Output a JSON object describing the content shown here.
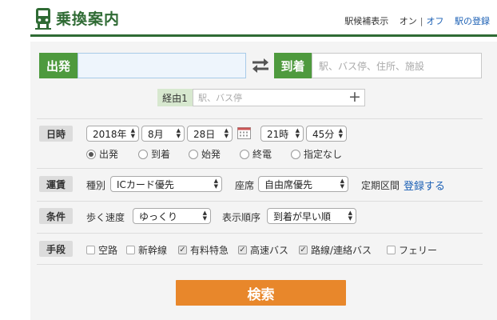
{
  "header": {
    "title": "乗換案内",
    "station_suggest_label": "駅候補表示",
    "suggest_on": "オン",
    "suggest_separator": "|",
    "suggest_off": "オフ",
    "register_stations": "駅の登録"
  },
  "route": {
    "from_label": "出発",
    "from_value": "",
    "to_label": "到着",
    "to_placeholder": "駅、バス停、住所、施設",
    "via_label": "経由1",
    "via_placeholder": "駅、バス停",
    "add_via": "+"
  },
  "datetime": {
    "label": "日時",
    "year": "2018年",
    "month": "8月",
    "day": "28日",
    "hour": "21時",
    "minute": "45分",
    "options": [
      "出発",
      "到着",
      "始発",
      "終電",
      "指定なし"
    ],
    "selected_index": 0
  },
  "fare": {
    "label": "運賃",
    "type_label": "種別",
    "type_value": "ICカード優先",
    "seat_label": "座席",
    "seat_value": "自由席優先",
    "commuter_label": "定期区間",
    "commuter_link": "登録する"
  },
  "conditions": {
    "label": "条件",
    "speed_label": "歩く速度",
    "speed_value": "ゆっくり",
    "order_label": "表示順序",
    "order_value": "到着が早い順"
  },
  "means": {
    "label": "手段",
    "options": [
      {
        "label": "空路",
        "checked": false
      },
      {
        "label": "新幹線",
        "checked": false
      },
      {
        "label": "有料特急",
        "checked": true
      },
      {
        "label": "高速バス",
        "checked": true
      },
      {
        "label": "路線/連絡バス",
        "checked": true
      },
      {
        "label": "フェリー",
        "checked": false
      }
    ]
  },
  "search_button": "検索",
  "colors": {
    "brand_green": "#2f6b34",
    "label_green": "#4e9a3e",
    "search_orange": "#e8872b",
    "link_blue": "#1a5fb4"
  }
}
